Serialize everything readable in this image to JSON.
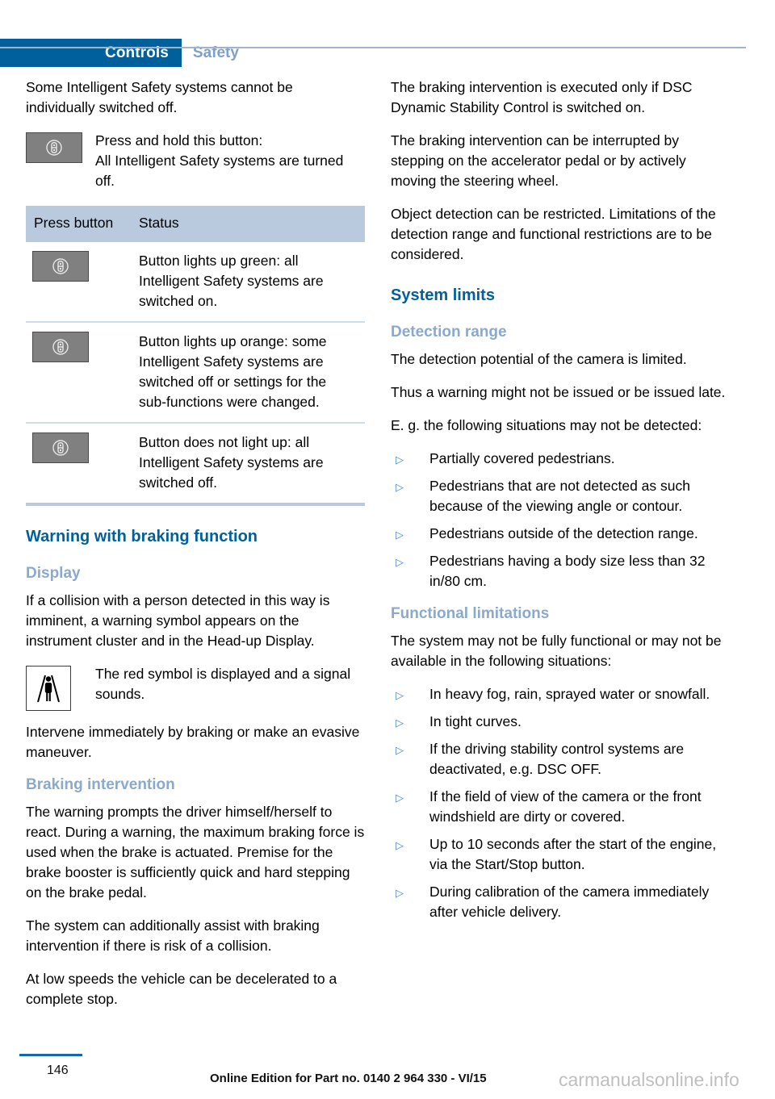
{
  "header": {
    "tab_active": "Controls",
    "tab_inactive": "Safety",
    "accent_color": "#00609c",
    "inactive_color": "#7fa0c8"
  },
  "left_column": {
    "intro_paragraph": "Some Intelligent Safety systems cannot be individually switched off.",
    "press_hold": {
      "icon": "intelligent-safety-button-icon",
      "line1": "Press and hold this button:",
      "line2": "All Intelligent Safety systems are turned off."
    },
    "table": {
      "headers": [
        "Press button",
        "Status"
      ],
      "header_col1": "Press button",
      "header_col2": "Status",
      "rows": [
        {
          "icon": "intelligent-safety-button-icon",
          "status": "Button lights up green: all Intelligent Safety systems are switched on."
        },
        {
          "icon": "intelligent-safety-button-icon",
          "status": "Button lights up orange: some Intelligent Safety systems are switched off or settings for the sub-functions were changed."
        },
        {
          "icon": "intelligent-safety-button-icon",
          "status": "Button does not light up: all Intelligent Safety systems are switched off."
        }
      ]
    },
    "warning_section": {
      "title": "Warning with braking function",
      "display": {
        "subtitle": "Display",
        "paragraph": "If a collision with a person detected in this way is imminent, a warning symbol appears on the instrument cluster and in the Head-up Display.",
        "symbol_icon": "pedestrian-warning-icon",
        "symbol_text": "The red symbol is displayed and a signal sounds.",
        "follow_up": "Intervene immediately by braking or make an evasive maneuver."
      },
      "braking": {
        "subtitle": "Braking intervention",
        "paragraphs": [
          "The warning prompts the driver himself/herself to react. During a warning, the maximum braking force is used when the brake is actuated. Premise for the brake booster is sufficiently quick and hard stepping on the brake pedal.",
          "The system can additionally assist with braking intervention if there is risk of a collision.",
          "At low speeds the vehicle can be decelerated to a complete stop."
        ]
      }
    }
  },
  "right_column": {
    "paragraphs": [
      "The braking intervention is executed only if DSC Dynamic Stability Control is switched on.",
      "The braking intervention can be interrupted by stepping on the accelerator pedal or by actively moving the steering wheel.",
      "Object detection can be restricted. Limitations of the detection range and functional restrictions are to be considered."
    ],
    "system_limits": {
      "title": "System limits",
      "detection_range": {
        "subtitle": "Detection range",
        "paragraphs": [
          "The detection potential of the camera is limited.",
          "Thus a warning might not be issued or be issued late.",
          "E. g. the following situations may not be detected:"
        ],
        "bullets": [
          "Partially covered pedestrians.",
          "Pedestrians that are not detected as such because of the viewing angle or contour.",
          "Pedestrians outside of the detection range.",
          "Pedestrians having a body size less than 32 in/80 cm."
        ]
      },
      "functional_limitations": {
        "subtitle": "Functional limitations",
        "paragraph": "The system may not be fully functional or may not be available in the following situations:",
        "bullets": [
          "In heavy fog, rain, sprayed water or snowfall.",
          "In tight curves.",
          "If the driving stability control systems are deactivated, e.g. DSC OFF.",
          "If the field of view of the camera or the front windshield are dirty or covered.",
          "Up to 10 seconds after the start of the engine, via the Start/Stop button.",
          "During calibration of the camera immediately after vehicle delivery."
        ]
      }
    }
  },
  "footer": {
    "page_number": "146",
    "edition": "Online Edition for Part no. 0140 2 964 330 - VI/15",
    "watermark": "carmanualsonline.info"
  },
  "bullet_glyph": "▷"
}
